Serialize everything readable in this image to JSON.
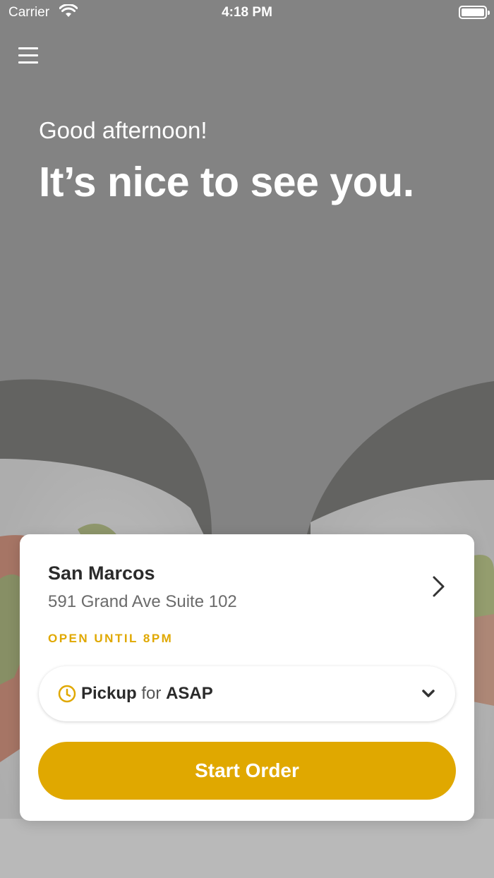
{
  "status_bar": {
    "carrier": "Carrier",
    "time": "4:18 PM"
  },
  "icons": {
    "menu": "hamburger-menu-icon",
    "wifi": "wifi-icon",
    "battery": "battery-icon",
    "clock": "clock-icon",
    "chevron_right": "chevron-right-icon",
    "chevron_down": "chevron-down-icon"
  },
  "hero": {
    "greeting": "Good afternoon!",
    "headline": "It’s nice to see you."
  },
  "location_card": {
    "store_name": "San Marcos",
    "address": "591 Grand Ave Suite 102",
    "open_status": "OPEN UNTIL 8PM",
    "order_type": "Pickup",
    "for_label": "for",
    "order_time": "ASAP",
    "start_order_label": "Start Order"
  },
  "colors": {
    "accent": "#e0a800",
    "overlay": "#838383",
    "card": "#ffffff"
  }
}
